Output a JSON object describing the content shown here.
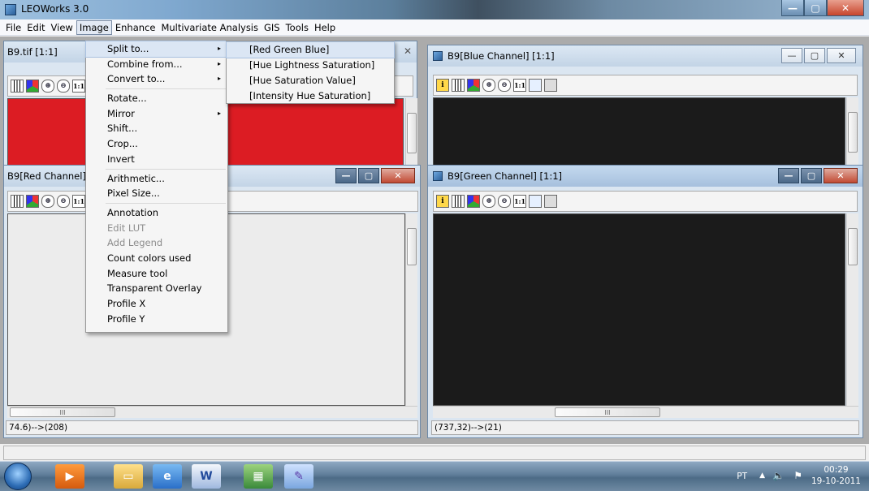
{
  "app": {
    "title": "LEOWorks 3.0"
  },
  "menubar": [
    "File",
    "Edit",
    "View",
    "Image",
    "Enhance",
    "Multivariate Analysis",
    "GIS",
    "Tools",
    "Help"
  ],
  "image_menu": {
    "items": [
      {
        "label": "Split to...",
        "arrow": "▸"
      },
      {
        "label": "Combine from...",
        "arrow": "▸"
      },
      {
        "label": "Convert to...",
        "arrow": "▸"
      },
      {
        "sep": true
      },
      {
        "label": "Rotate..."
      },
      {
        "label": "Mirror",
        "arrow": "▸"
      },
      {
        "label": "Shift..."
      },
      {
        "label": "Crop..."
      },
      {
        "label": "Invert"
      },
      {
        "sep": true
      },
      {
        "label": "Arithmetic..."
      },
      {
        "label": "Pixel Size..."
      },
      {
        "sep": true
      },
      {
        "label": "Annotation"
      },
      {
        "label": "Edit LUT",
        "disabled": true
      },
      {
        "label": "Add Legend",
        "disabled": true
      },
      {
        "label": "Count colors used"
      },
      {
        "label": "Measure tool"
      },
      {
        "label": "Transparent Overlay"
      },
      {
        "label": "Profile X"
      },
      {
        "label": "Profile Y"
      }
    ]
  },
  "split_submenu": [
    "[Red Green Blue]",
    "[Hue Lightness Saturation]",
    "[Hue Saturation Value]",
    "[Intensity Hue Saturation]"
  ],
  "windows": {
    "b9tif": {
      "title": "B9.tif [1:1]"
    },
    "blue": {
      "title": "B9[Blue Channel] [1:1]"
    },
    "red": {
      "title": "B9[Red Channel] [1:1]",
      "status": "74.6)-->(208)"
    },
    "green": {
      "title": "B9[Green Channel] [1:1]",
      "status": "(737,32)-->(21)"
    }
  },
  "scroll_grip": "III",
  "toolbar_labels": {
    "info": "i",
    "zoom_in": "⊕",
    "zoom_out": "⊖",
    "one_to_one": "1:1"
  },
  "taskbar": {
    "lang": "PT",
    "time": "00:29",
    "date": "19-10-2011"
  },
  "colors": {
    "red_image": "#dc1c23",
    "dark_image": "#1b1b1b",
    "grey_image": "#ececec"
  }
}
